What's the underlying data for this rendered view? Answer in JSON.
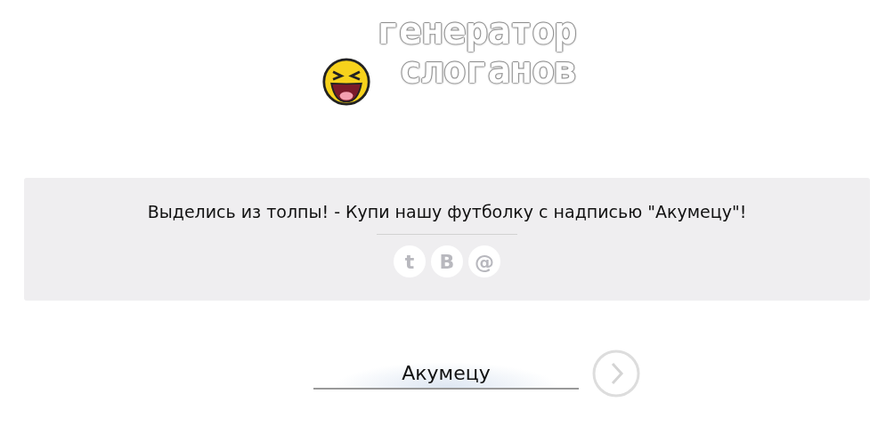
{
  "logo": {
    "lines": [
      "генератор",
      "слоганов"
    ]
  },
  "slogan": {
    "text": "Выделись из толпы! - Купи нашу футболку с надписью \"Акумецу\"!",
    "share": [
      "t",
      "B",
      "@"
    ]
  },
  "form": {
    "value": "Акумецу"
  }
}
